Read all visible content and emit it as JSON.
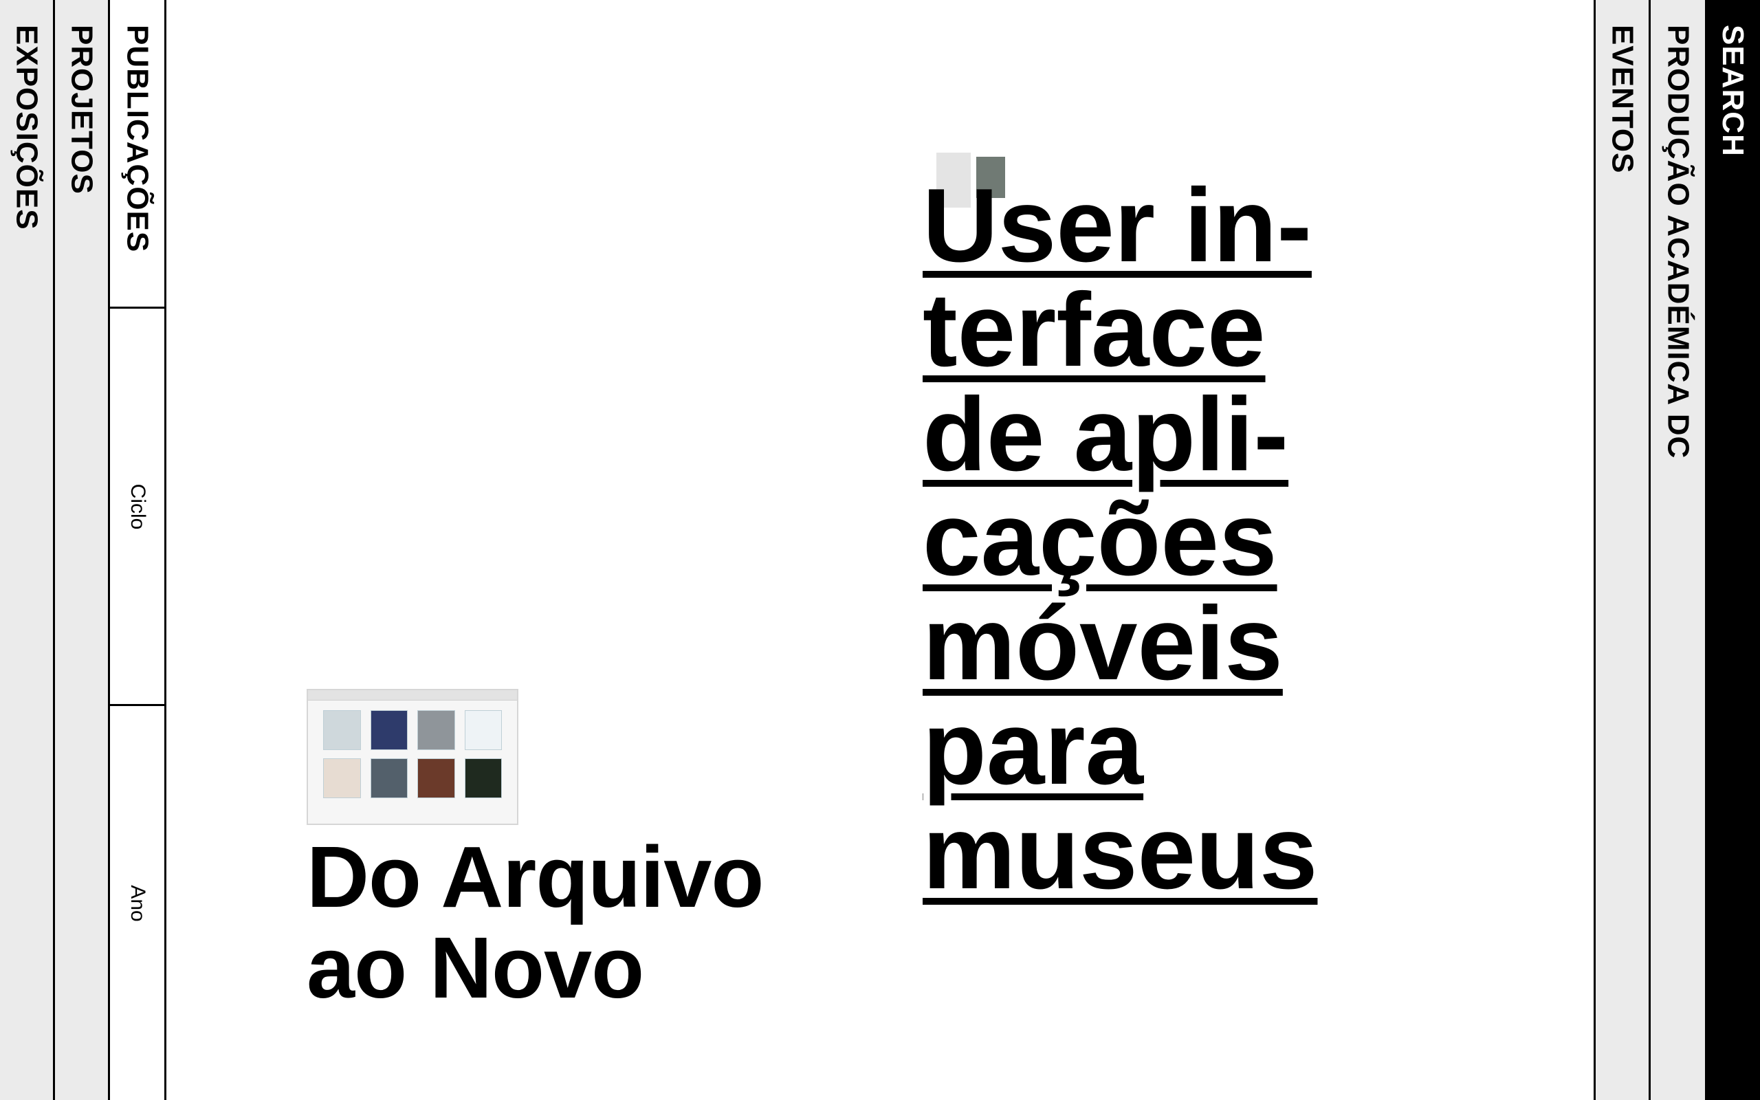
{
  "left_tabs": [
    {
      "label": "EXPOSIÇÕES"
    },
    {
      "label": "PROJETOS"
    },
    {
      "label": "PUBLICAÇÕES"
    }
  ],
  "filters": {
    "ciclo": "Ciclo",
    "ano": "Ano"
  },
  "right_tabs": [
    {
      "label": "EVENTOS"
    },
    {
      "label": "PRODUÇÃO ACADÉMICA DC"
    },
    {
      "label": "SEARCH"
    }
  ],
  "publications": [
    {
      "title_lines": [
        "Do Arquivo",
        "ao Novo"
      ]
    },
    {
      "title_lines": [
        "User in-",
        "terface",
        "de apli-",
        "cações",
        "móveis",
        "para",
        "museus"
      ]
    }
  ]
}
